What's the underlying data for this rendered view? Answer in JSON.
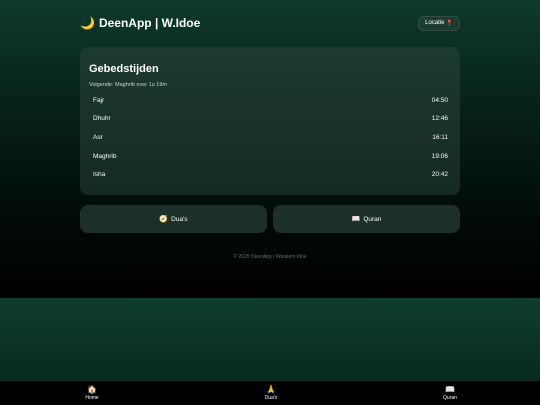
{
  "header": {
    "title": "DeenApp | W.Idoe",
    "location_label": "Locatie"
  },
  "prayer_card": {
    "title": "Gebedstijden",
    "next": "Volgende: Maghrib over 1u 19m",
    "prayers": [
      {
        "name": "Fajr",
        "time": "04:50"
      },
      {
        "name": "Dhuhr",
        "time": "12:46"
      },
      {
        "name": "Asr",
        "time": "16:11"
      },
      {
        "name": "Maghrib",
        "time": "19:06"
      },
      {
        "name": "Isha",
        "time": "20:42"
      }
    ]
  },
  "buttons": {
    "duas": "Dua's",
    "quran": "Quran"
  },
  "footer": "© 2025 DeenApp | Waseem Idoe",
  "nav": {
    "home": "Home",
    "duas": "Dua's",
    "quran": "Quran"
  },
  "colors": {
    "card": "#1d3a31",
    "button": "#1c2f29",
    "accent_moon": "#f2d04b"
  }
}
